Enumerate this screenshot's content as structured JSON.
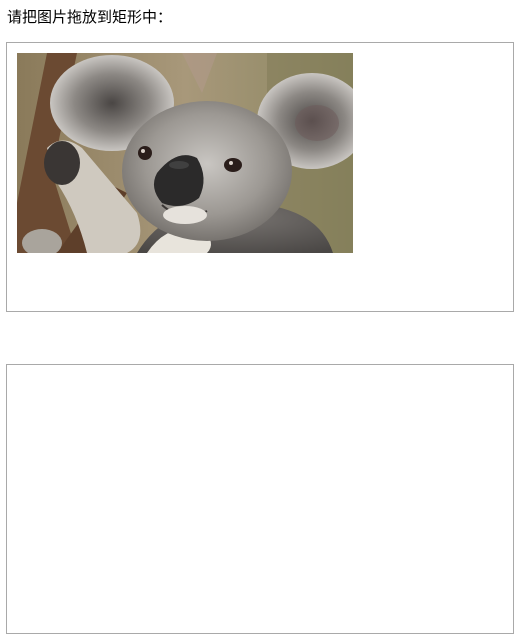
{
  "instruction": {
    "text": "请把图片拖放到矩形中："
  },
  "image": {
    "subject_icon": "koala-photo",
    "alt": "koala"
  },
  "colors": {
    "border": "#a9a9a9",
    "background": "#ffffff",
    "text": "#000000"
  }
}
